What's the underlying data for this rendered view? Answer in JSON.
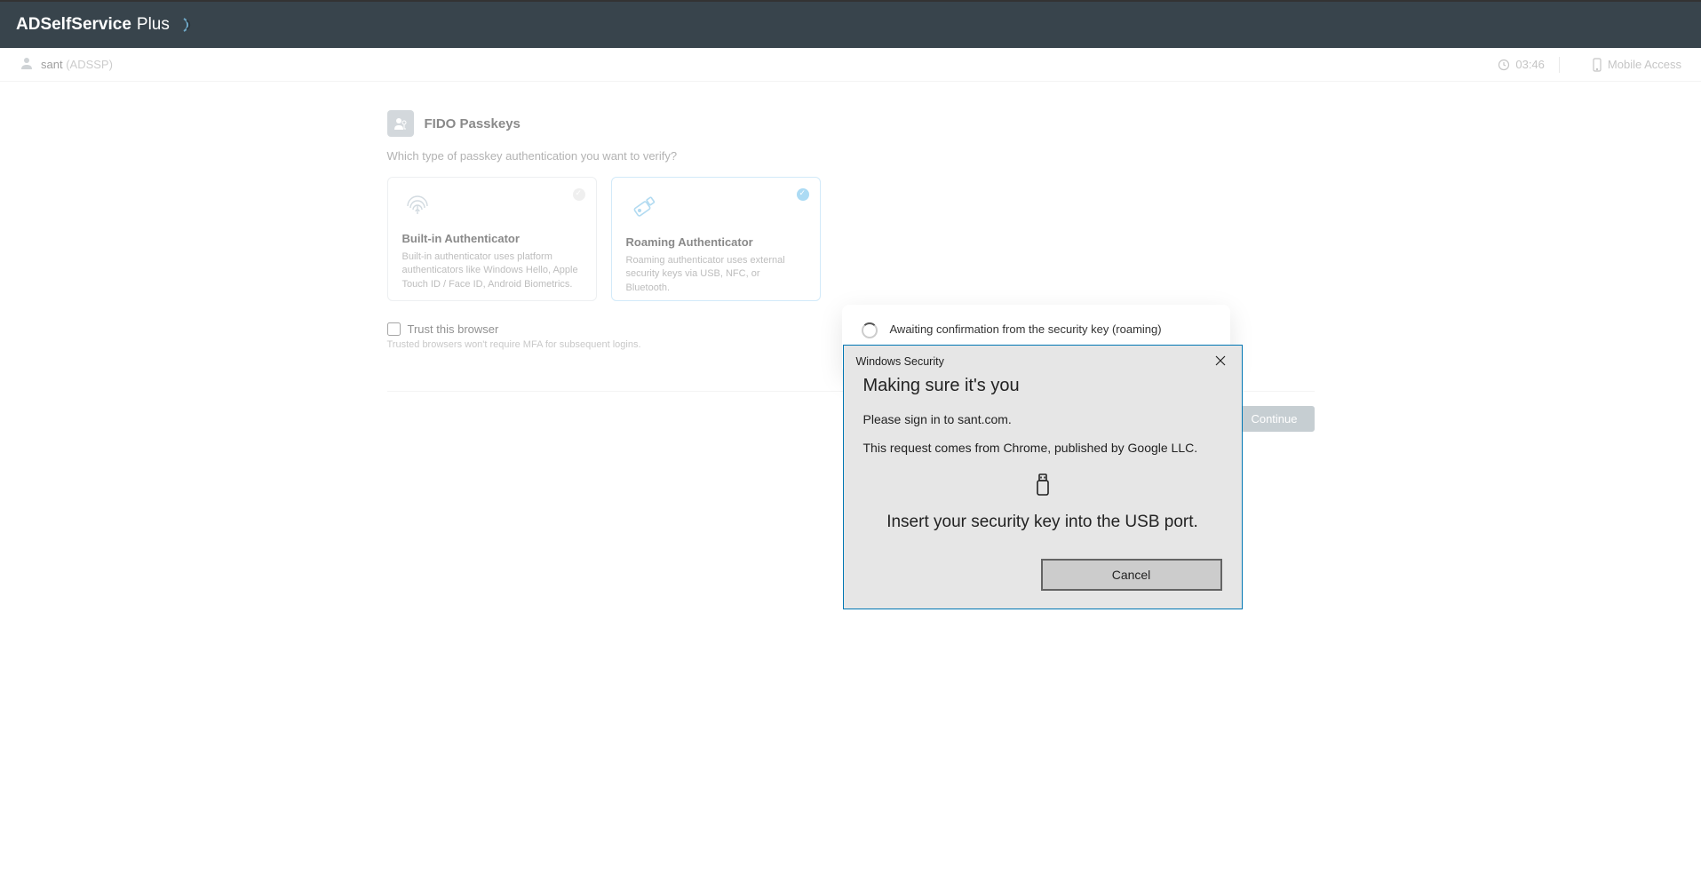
{
  "header": {
    "brand_bold": "ADSelfService",
    "brand_light": "Plus"
  },
  "userbar": {
    "username": "sant",
    "domain": "(ADSSP)",
    "time": "03:46",
    "mobile_label": "Mobile Access"
  },
  "section": {
    "title": "FIDO Passkeys",
    "prompt": "Which type of passkey authentication you want to verify?"
  },
  "cards": {
    "builtin": {
      "title": "Built-in Authenticator",
      "desc": "Built-in authenticator uses platform authenticators like Windows Hello, Apple Touch ID / Face ID, Android Biometrics."
    },
    "roaming": {
      "title": "Roaming Authenticator",
      "desc": "Roaming authenticator uses external security keys via USB, NFC, or Bluetooth."
    }
  },
  "trust": {
    "label": "Trust this browser",
    "note": "Trusted browsers won't require MFA for subsequent logins."
  },
  "actions": {
    "cancel": "Cancel",
    "continue": "Continue"
  },
  "await": {
    "text": "Awaiting confirmation from the security key (roaming)"
  },
  "ws": {
    "title": "Windows Security",
    "heading": "Making sure it's you",
    "line1": "Please sign in to sant.com.",
    "line2": "This request comes from Chrome, published by Google LLC.",
    "instruction": "Insert your security key into the USB port.",
    "cancel": "Cancel"
  }
}
